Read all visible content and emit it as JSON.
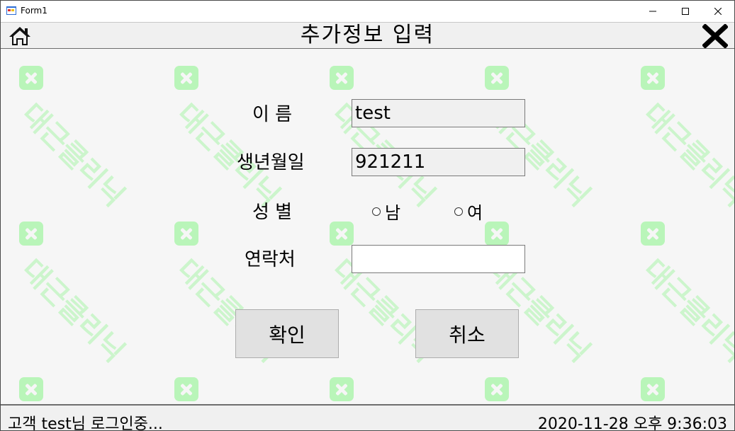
{
  "window": {
    "title": "Form1",
    "minimize": "—",
    "maximize": "☐",
    "close": "✕"
  },
  "header": {
    "title": "추가정보 입력",
    "home_icon": "home-icon",
    "close_icon": "close-x-icon"
  },
  "watermark": {
    "text": "대근클리닉",
    "color": "#b9f5b9"
  },
  "form": {
    "name_label": "이 름",
    "name_value": "test",
    "birth_label": "생년월일",
    "birth_value": "921211",
    "gender_label": "성 별",
    "gender_male": "남",
    "gender_female": "여",
    "contact_label": "연락처",
    "contact_value": ""
  },
  "buttons": {
    "confirm": "확인",
    "cancel": "취소"
  },
  "status": {
    "login": "고객 test님 로그인중...",
    "datetime": "2020-11-28 오후 9:36:03"
  }
}
